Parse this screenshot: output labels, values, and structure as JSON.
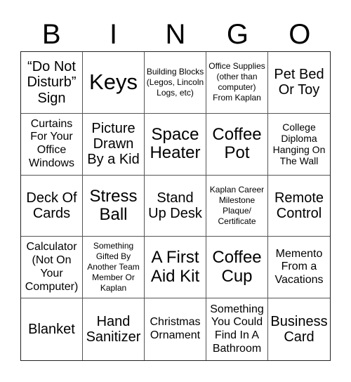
{
  "header": {
    "letters": [
      "B",
      "I",
      "N",
      "G",
      "O"
    ]
  },
  "cells": [
    {
      "text": "“Do Not Disturb” Sign",
      "size": "md"
    },
    {
      "text": "Keys",
      "size": "xl"
    },
    {
      "text": "Building Blocks (Legos, Lincoln Logs, etc)",
      "size": "xxs"
    },
    {
      "text": "Office Supplies (other than computer) From Kaplan",
      "size": "xxs"
    },
    {
      "text": "Pet Bed Or Toy",
      "size": "md"
    },
    {
      "text": "Curtains For Your Office Windows",
      "size": "sm"
    },
    {
      "text": "Picture Drawn By a Kid",
      "size": "md"
    },
    {
      "text": "Space Heater",
      "size": "lg"
    },
    {
      "text": "Coffee Pot",
      "size": "lg"
    },
    {
      "text": "College Diploma Hanging On The Wall",
      "size": "xs"
    },
    {
      "text": "Deck Of Cards",
      "size": "md"
    },
    {
      "text": "Stress Ball",
      "size": "lg"
    },
    {
      "text": "Stand Up Desk",
      "size": "md"
    },
    {
      "text": "Kaplan Career Milestone Plaque/ Certificate",
      "size": "xxs"
    },
    {
      "text": "Remote Control",
      "size": "md"
    },
    {
      "text": "Calculator (Not On Your Computer)",
      "size": "sm"
    },
    {
      "text": "Something Gifted By Another Team Member Or Kaplan",
      "size": "xxs"
    },
    {
      "text": "A First Aid Kit",
      "size": "lg"
    },
    {
      "text": "Coffee Cup",
      "size": "lg"
    },
    {
      "text": "Memento From a Vacations",
      "size": "sm"
    },
    {
      "text": "Blanket",
      "size": "md"
    },
    {
      "text": "Hand Sanitizer",
      "size": "md"
    },
    {
      "text": "Christmas Ornament",
      "size": "sm"
    },
    {
      "text": "Something You Could Find In A Bathroom",
      "size": "sm"
    },
    {
      "text": "Business Card",
      "size": "md"
    }
  ]
}
